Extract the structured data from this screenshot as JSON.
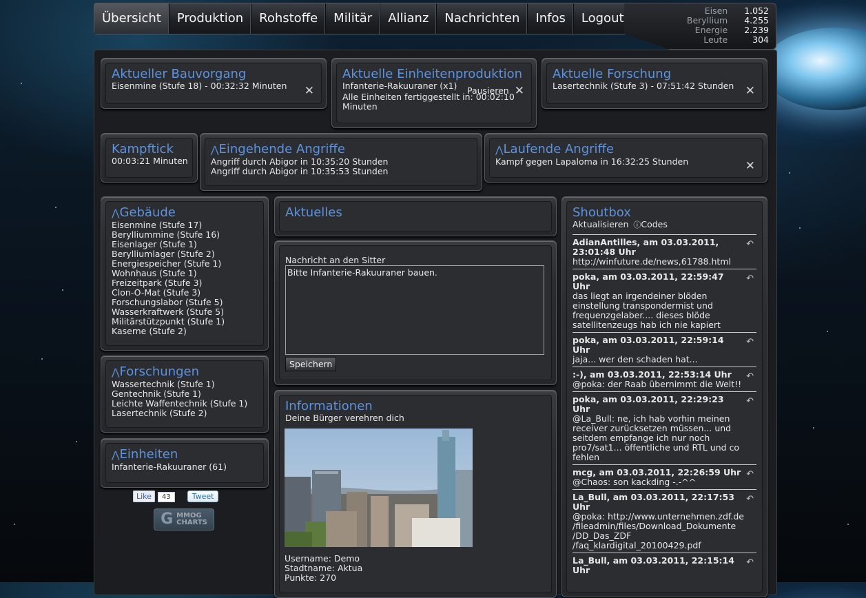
{
  "nav": {
    "tabs": [
      "Übersicht",
      "Produktion",
      "Rohstoffe",
      "Militär",
      "Allianz",
      "Nachrichten",
      "Infos",
      "Logout"
    ],
    "active": 0
  },
  "resources": [
    {
      "label": "Eisen",
      "value": "1.052"
    },
    {
      "label": "Beryllium",
      "value": "4.255"
    },
    {
      "label": "Energie",
      "value": "2.239"
    },
    {
      "label": "Leute",
      "value": "304"
    }
  ],
  "construction": {
    "title": "Aktueller Bauvorgang",
    "text": "Eisenmine (Stufe 18) - 00:32:32 Minuten"
  },
  "unitprod": {
    "title": "Aktuelle Einheitenproduktion",
    "item": "Infanterie-Rakuuraner (x1)",
    "pause": "Pausieren",
    "done_line1": "Alle Einheiten fertiggestellt in: 00:02:10",
    "done_line2": "Minuten"
  },
  "research": {
    "title": "Aktuelle Forschung",
    "text": "Lasertechnik (Stufe 3) - 07:51:42 Stunden"
  },
  "kampftick": {
    "title": "Kampftick",
    "text": "00:03:21 Minuten"
  },
  "incoming": {
    "title": "Eingehende Angriffe",
    "lines": [
      "Angriff durch Abigor in 10:35:20 Stunden",
      "Angriff durch Abigor in 10:35:53 Stunden"
    ]
  },
  "running": {
    "title": "Laufende Angriffe",
    "text": "Kampf gegen Lapaloma in 16:32:25 Stunden"
  },
  "buildings": {
    "title": "Gebäude",
    "items": [
      "Eisenmine (Stufe 17)",
      "Berylliummine (Stufe 16)",
      "Eisenlager (Stufe 1)",
      "Berylliumlager (Stufe 2)",
      "Energiespeicher (Stufe 1)",
      "Wohnhaus (Stufe 1)",
      "Freizeitpark (Stufe 3)",
      "Clon-O-Mat (Stufe 3)",
      "Forschungslabor (Stufe 5)",
      "Wasserkraftwerk (Stufe 5)",
      "Militärstützpunkt (Stufe 1)",
      "Kaserne (Stufe 2)"
    ]
  },
  "researches": {
    "title": "Forschungen",
    "items": [
      "Wassertechnik (Stufe 1)",
      "Gentechnik (Stufe 1)",
      "Leichte Waffentechnik (Stufe 1)",
      "Lasertechnik (Stufe 2)"
    ]
  },
  "units": {
    "title": "Einheiten",
    "items": [
      "Infanterie-Rakuuraner (61)"
    ]
  },
  "social": {
    "like": "Like",
    "like_count": "43",
    "tweet": "Tweet",
    "mmog_line1": "MMOG",
    "mmog_line2": "CHARTS"
  },
  "news": {
    "title": "Aktuelles"
  },
  "sitter": {
    "label": "Nachricht an den Sitter",
    "message": "Bitte Infanterie-Rakuuraner bauen.",
    "save": "Speichern"
  },
  "info": {
    "title": "Informationen",
    "subtitle": "Deine Bürger verehren dich",
    "username": "Username: Demo",
    "city": "Stadtname: Aktua",
    "points": "Punkte: 270"
  },
  "shoutbox": {
    "title": "Shoutbox",
    "refresh": "Aktualisieren",
    "codes": "Codes",
    "entries": [
      {
        "who": "AdianAntilles, am 03.03.2011, 23:01:48 Uhr",
        "msg": "http://winfuture.de/news,61788.html"
      },
      {
        "who": "poka, am 03.03.2011, 22:59:47 Uhr",
        "msg": "das liegt an irgendeiner blöden einstellung transpondermist und frequenzgelaber.... dieses blöde satellitenzeugs hab ich nie kapiert"
      },
      {
        "who": "poka, am 03.03.2011, 22:59:14 Uhr",
        "msg": "jaja... wer den schaden hat..."
      },
      {
        "who": ":-), am 03.03.2011, 22:53:14 Uhr",
        "msg": "@poka: der Raab übernimmt die Welt!!"
      },
      {
        "who": "poka, am 03.03.2011, 22:29:23 Uhr",
        "msg": "@La_Bull: ne, ich hab vorhin meinen receiver zurücksetzen müssen... und seitdem empfange ich nur noch pro7/sat1... öffentliche und RTL und co fehlen"
      },
      {
        "who": "mcg, am 03.03.2011, 22:26:59 Uhr",
        "msg": "@Chaos: son kackding -.-^^"
      },
      {
        "who": "La_Bull, am 03.03.2011, 22:17:53 Uhr",
        "msg": "@poka: http://www.unternehmen.zdf.de /fileadmin/files/Download_Dokumente /DD_Das_ZDF /faq_klardigital_20100429.pdf"
      },
      {
        "who": "La_Bull, am 03.03.2011, 22:15:14 Uhr",
        "msg": ""
      }
    ]
  }
}
